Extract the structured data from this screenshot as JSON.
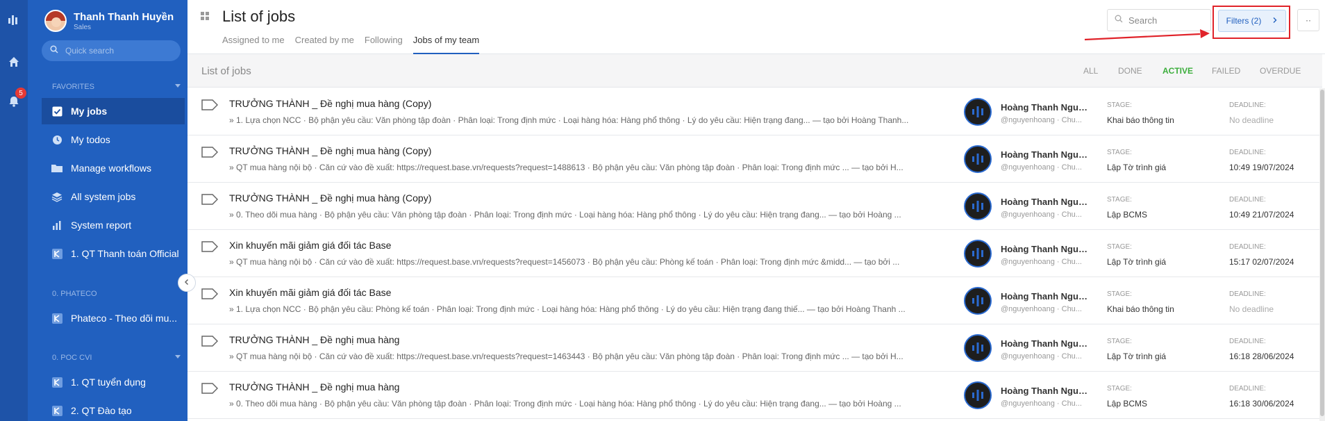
{
  "user": {
    "name": "Thanh Thanh Huyền",
    "role": "Sales"
  },
  "sidebar": {
    "search_placeholder": "Quick search",
    "favorites_label": "FAVORITES",
    "items": [
      {
        "label": "My jobs",
        "icon": "checkbox-icon"
      },
      {
        "label": "My todos",
        "icon": "clock-icon"
      },
      {
        "label": "Manage workflows",
        "icon": "folder-icon"
      },
      {
        "label": "All system jobs",
        "icon": "layers-icon"
      },
      {
        "label": "System report",
        "icon": "bar-chart-icon"
      },
      {
        "label": "1. QT Thanh toán Official",
        "icon": "workflow-icon"
      }
    ],
    "group1": {
      "label": "0. PHATECO",
      "items": [
        {
          "label": "Phateco - Theo dõi mu..."
        }
      ]
    },
    "group2": {
      "label": "0. POC CVI",
      "items": [
        {
          "label": "1. QT tuyển dụng"
        },
        {
          "label": "2. QT Đào tạo"
        }
      ]
    }
  },
  "rail": {
    "notification_count": "5"
  },
  "header": {
    "title": "List of jobs",
    "tabs": [
      "Assigned to me",
      "Created by me",
      "Following",
      "Jobs of my team"
    ],
    "search_placeholder": "Search",
    "filters_label": "Filters (2)",
    "more_label": "··"
  },
  "subbar": {
    "title": "List of jobs",
    "statuses": [
      "ALL",
      "DONE",
      "ACTIVE",
      "FAILED",
      "OVERDUE"
    ]
  },
  "labels": {
    "stage": "STAGE:",
    "deadline": "DEADLINE:"
  },
  "jobs": [
    {
      "title": "TRƯỞNG THÀNH _ Đề nghị mua hàng (Copy)",
      "desc": "» 1. Lựa chọn NCC · Bộ phận yêu cầu: Văn phòng tập đoàn · Phân loại: Trong định mức · Loại hàng hóa: Hàng phổ thông · Lý do yêu cầu: Hiện trạng đang... — tạo bởi Hoàng Thanh...",
      "assignee": "Hoàng Thanh Nguy...",
      "handle": "@nguyenhoang · Chu...",
      "stage": "Khai báo thông tin",
      "deadline": "No deadline"
    },
    {
      "title": "TRƯỞNG THÀNH _ Đề nghị mua hàng (Copy)",
      "desc": "» QT mua hàng nội bộ · Căn cứ vào đề xuất: https://request.base.vn/requests?request=1488613 · Bộ phận yêu cầu: Văn phòng tập đoàn · Phân loại: Trong định mức ... — tạo bởi H...",
      "assignee": "Hoàng Thanh Nguy...",
      "handle": "@nguyenhoang · Chu...",
      "stage": "Lập Tờ trình giá",
      "deadline": "10:49 19/07/2024"
    },
    {
      "title": "TRƯỞNG THÀNH _ Đề nghị mua hàng (Copy)",
      "desc": "» 0. Theo dõi mua hàng · Bộ phận yêu cầu: Văn phòng tập đoàn · Phân loại: Trong định mức · Loại hàng hóa: Hàng phổ thông · Lý do yêu cầu: Hiện trạng đang... — tạo bởi Hoàng ...",
      "assignee": "Hoàng Thanh Nguy...",
      "handle": "@nguyenhoang · Chu...",
      "stage": "Lập BCMS",
      "deadline": "10:49 21/07/2024"
    },
    {
      "title": "Xin khuyến mãi giảm giá đối tác Base",
      "desc": "» QT mua hàng nội bộ · Căn cứ vào đề xuất: https://request.base.vn/requests?request=1456073 · Bộ phận yêu cầu: Phòng kế toán · Phân loại: Trong định mức &midd... — tạo bởi ...",
      "assignee": "Hoàng Thanh Nguy...",
      "handle": "@nguyenhoang · Chu...",
      "stage": "Lập Tờ trình giá",
      "deadline": "15:17 02/07/2024"
    },
    {
      "title": "Xin khuyến mãi giảm giá đối tác Base",
      "desc": "» 1. Lựa chọn NCC · Bộ phận yêu cầu: Phòng kế toán · Phân loại: Trong định mức · Loại hàng hóa: Hàng phổ thông · Lý do yêu cầu: Hiện trạng đang thiế... — tạo bởi Hoàng Thanh ...",
      "assignee": "Hoàng Thanh Nguy...",
      "handle": "@nguyenhoang · Chu...",
      "stage": "Khai báo thông tin",
      "deadline": "No deadline"
    },
    {
      "title": "TRƯỞNG THÀNH _ Đề nghị mua hàng",
      "desc": "» QT mua hàng nội bộ · Căn cứ vào đề xuất: https://request.base.vn/requests?request=1463443 · Bộ phận yêu cầu: Văn phòng tập đoàn · Phân loại: Trong định mức ... — tạo bởi H...",
      "assignee": "Hoàng Thanh Nguy...",
      "handle": "@nguyenhoang · Chu...",
      "stage": "Lập Tờ trình giá",
      "deadline": "16:18 28/06/2024"
    },
    {
      "title": "TRƯỞNG THÀNH _ Đề nghị mua hàng",
      "desc": "» 0. Theo dõi mua hàng · Bộ phận yêu cầu: Văn phòng tập đoàn · Phân loại: Trong định mức · Loại hàng hóa: Hàng phổ thông · Lý do yêu cầu: Hiện trạng đang... — tạo bởi Hoàng ...",
      "assignee": "Hoàng Thanh Nguy...",
      "handle": "@nguyenhoang · Chu...",
      "stage": "Lập BCMS",
      "deadline": "16:18 30/06/2024"
    }
  ],
  "colors": {
    "sidebar": "#2160bf",
    "rail": "#1e53a8",
    "accent": "#2160bf",
    "active_status": "#3dae3d",
    "highlight": "#e0232a"
  }
}
